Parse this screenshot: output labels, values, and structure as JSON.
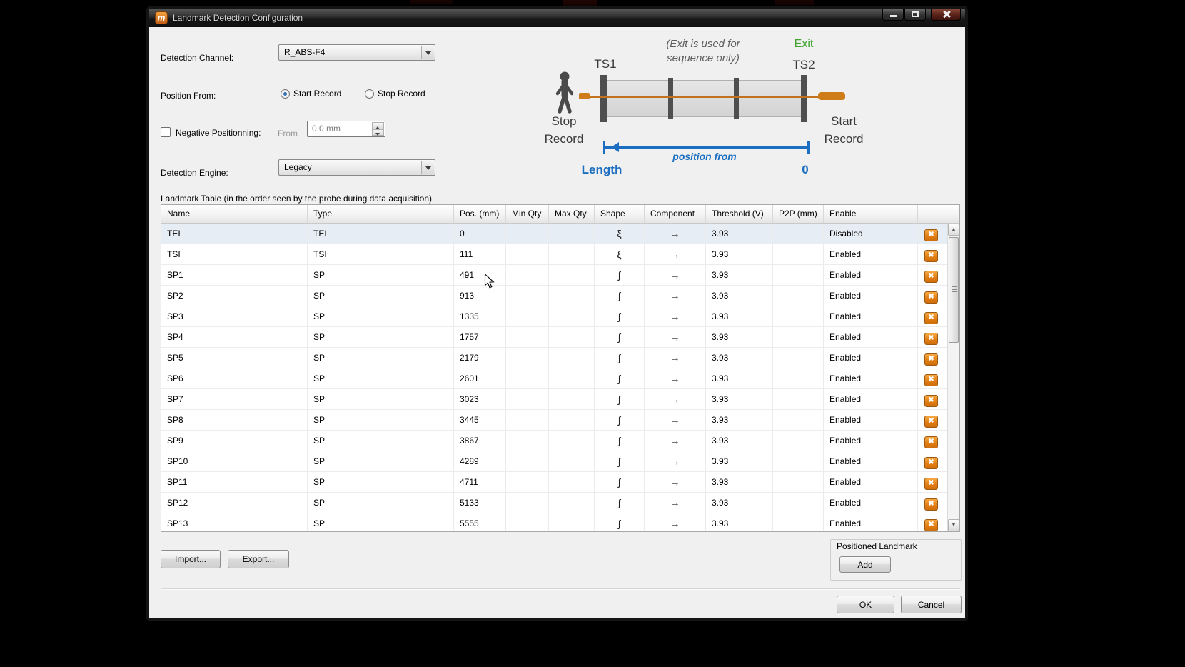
{
  "window": {
    "title": "Landmark Detection Configuration",
    "icon_letter": "m"
  },
  "form": {
    "detection_channel_label": "Detection Channel:",
    "detection_channel_value": "R_ABS-F4",
    "position_from_label": "Position From:",
    "radio_start_label": "Start Record",
    "radio_stop_label": "Stop Record",
    "negative_positioning_label": "Negative Positionning:",
    "from_label": "From",
    "negative_positioning_value": "0.0 mm",
    "detection_engine_label": "Detection Engine:",
    "detection_engine_value": "Legacy"
  },
  "diagram": {
    "note_line1": "(Exit is used for",
    "note_line2": "sequence only)",
    "exit_label": "Exit",
    "ts1_label": "TS1",
    "ts2_label": "TS2",
    "stop_line1": "Stop",
    "stop_line2": "Record",
    "start_line1": "Start",
    "start_line2": "Record",
    "position_from_label": "position from",
    "length_label": "Length",
    "zero_label": "0",
    "accent_blue": "#1c6fc0",
    "accent_green": "#3fa32e",
    "wire_orange": "#c0731c"
  },
  "table": {
    "caption": "Landmark Table (in the order seen by the probe during data acquisition)",
    "columns": [
      "Name",
      "Type",
      "Pos. (mm)",
      "Min Qty",
      "Max Qty",
      "Shape",
      "Component",
      "Threshold (V)",
      "P2P (mm)",
      "Enable",
      ""
    ],
    "rows": [
      {
        "name": "TEI",
        "type": "TEI",
        "pos": "0",
        "min_qty": "",
        "max_qty": "",
        "shape": "ξ",
        "component": "→",
        "threshold": "3.93",
        "p2p": "",
        "enable": "Disabled",
        "selected": true
      },
      {
        "name": "TSI",
        "type": "TSI",
        "pos": "111",
        "min_qty": "",
        "max_qty": "",
        "shape": "ξ",
        "component": "→",
        "threshold": "3.93",
        "p2p": "",
        "enable": "Enabled",
        "selected": false
      },
      {
        "name": "SP1",
        "type": "SP",
        "pos": "491",
        "min_qty": "",
        "max_qty": "",
        "shape": "ʃ",
        "component": "→",
        "threshold": "3.93",
        "p2p": "",
        "enable": "Enabled",
        "selected": false
      },
      {
        "name": "SP2",
        "type": "SP",
        "pos": "913",
        "min_qty": "",
        "max_qty": "",
        "shape": "ʃ",
        "component": "→",
        "threshold": "3.93",
        "p2p": "",
        "enable": "Enabled",
        "selected": false
      },
      {
        "name": "SP3",
        "type": "SP",
        "pos": "1335",
        "min_qty": "",
        "max_qty": "",
        "shape": "ʃ",
        "component": "→",
        "threshold": "3.93",
        "p2p": "",
        "enable": "Enabled",
        "selected": false
      },
      {
        "name": "SP4",
        "type": "SP",
        "pos": "1757",
        "min_qty": "",
        "max_qty": "",
        "shape": "ʃ",
        "component": "→",
        "threshold": "3.93",
        "p2p": "",
        "enable": "Enabled",
        "selected": false
      },
      {
        "name": "SP5",
        "type": "SP",
        "pos": "2179",
        "min_qty": "",
        "max_qty": "",
        "shape": "ʃ",
        "component": "→",
        "threshold": "3.93",
        "p2p": "",
        "enable": "Enabled",
        "selected": false
      },
      {
        "name": "SP6",
        "type": "SP",
        "pos": "2601",
        "min_qty": "",
        "max_qty": "",
        "shape": "ʃ",
        "component": "→",
        "threshold": "3.93",
        "p2p": "",
        "enable": "Enabled",
        "selected": false
      },
      {
        "name": "SP7",
        "type": "SP",
        "pos": "3023",
        "min_qty": "",
        "max_qty": "",
        "shape": "ʃ",
        "component": "→",
        "threshold": "3.93",
        "p2p": "",
        "enable": "Enabled",
        "selected": false
      },
      {
        "name": "SP8",
        "type": "SP",
        "pos": "3445",
        "min_qty": "",
        "max_qty": "",
        "shape": "ʃ",
        "component": "→",
        "threshold": "3.93",
        "p2p": "",
        "enable": "Enabled",
        "selected": false
      },
      {
        "name": "SP9",
        "type": "SP",
        "pos": "3867",
        "min_qty": "",
        "max_qty": "",
        "shape": "ʃ",
        "component": "→",
        "threshold": "3.93",
        "p2p": "",
        "enable": "Enabled",
        "selected": false
      },
      {
        "name": "SP10",
        "type": "SP",
        "pos": "4289",
        "min_qty": "",
        "max_qty": "",
        "shape": "ʃ",
        "component": "→",
        "threshold": "3.93",
        "p2p": "",
        "enable": "Enabled",
        "selected": false
      },
      {
        "name": "SP11",
        "type": "SP",
        "pos": "4711",
        "min_qty": "",
        "max_qty": "",
        "shape": "ʃ",
        "component": "→",
        "threshold": "3.93",
        "p2p": "",
        "enable": "Enabled",
        "selected": false
      },
      {
        "name": "SP12",
        "type": "SP",
        "pos": "5133",
        "min_qty": "",
        "max_qty": "",
        "shape": "ʃ",
        "component": "→",
        "threshold": "3.93",
        "p2p": "",
        "enable": "Enabled",
        "selected": false
      },
      {
        "name": "SP13",
        "type": "SP",
        "pos": "5555",
        "min_qty": "",
        "max_qty": "",
        "shape": "ʃ",
        "component": "→",
        "threshold": "3.93",
        "p2p": "",
        "enable": "Enabled",
        "selected": false
      }
    ]
  },
  "footer": {
    "import_label": "Import...",
    "export_label": "Export...",
    "group_label": "Positioned Landmark",
    "add_label": "Add",
    "ok_label": "OK",
    "cancel_label": "Cancel"
  },
  "icons": {
    "delete": "✖",
    "scroll_up": "▲",
    "scroll_down": "▼"
  },
  "colors": {
    "delete_orange": "#e07c12",
    "selected_row": "#e7edf4",
    "dialog_bg": "#f0f0f0"
  }
}
